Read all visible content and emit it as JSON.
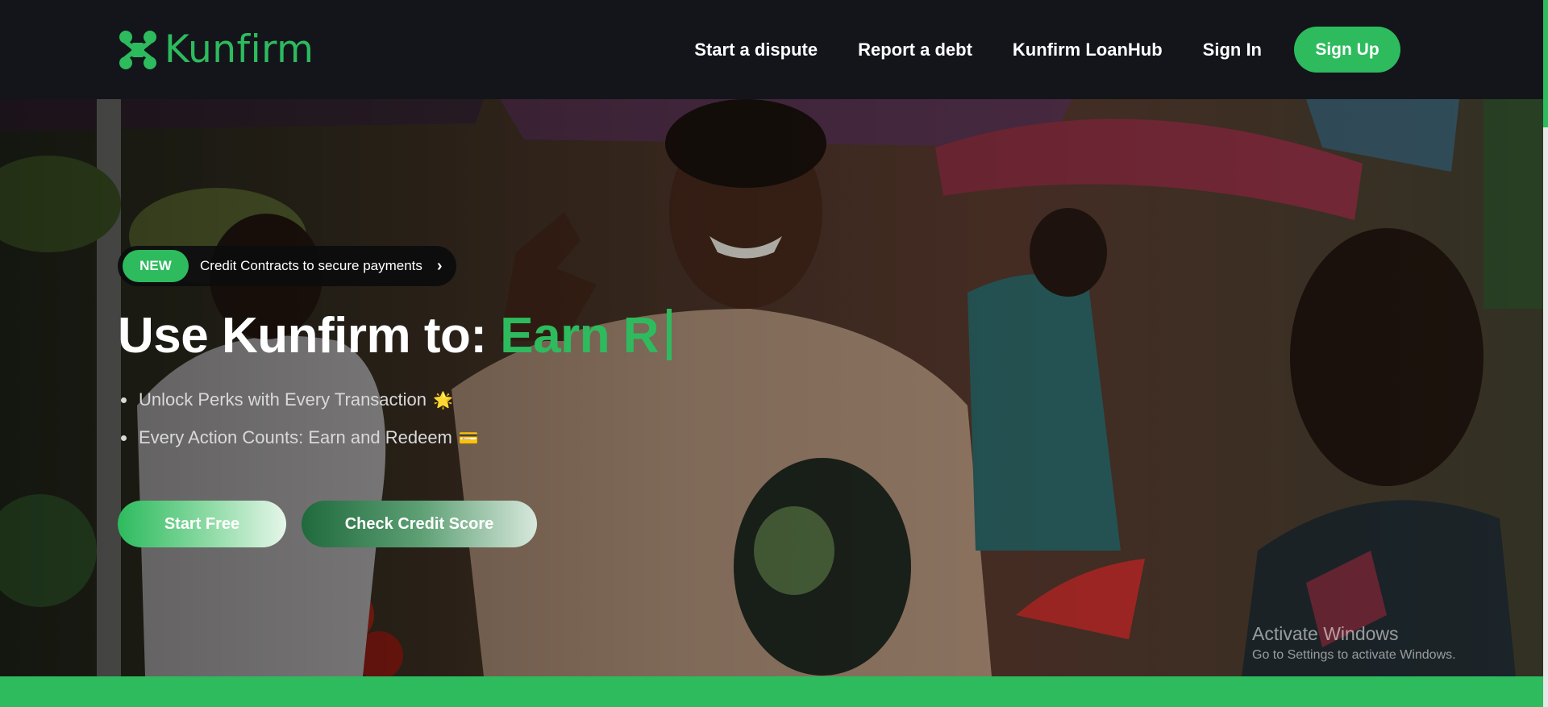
{
  "brand": {
    "name": "Kunfirm",
    "accent": "#2dbb5e"
  },
  "nav": {
    "links": [
      "Start a dispute",
      "Report a debt",
      "Kunfirm LoanHub",
      "Sign In"
    ],
    "signup_label": "Sign Up"
  },
  "hero": {
    "badge_new": "NEW",
    "badge_text": "Credit Contracts to secure payments",
    "badge_arrow": "›",
    "headline_static": "Use Kunfirm to: ",
    "headline_typed": "Earn R",
    "bullets": [
      {
        "text": "Unlock Perks with Every Transaction",
        "emoji": "🌟"
      },
      {
        "text": "Every Action Counts: Earn and Redeem",
        "emoji": "💳"
      }
    ],
    "start_label": "Start Free",
    "credit_label": "Check Credit Score"
  },
  "watermark": {
    "title": "Activate Windows",
    "subtitle": "Go to Settings to activate Windows."
  }
}
